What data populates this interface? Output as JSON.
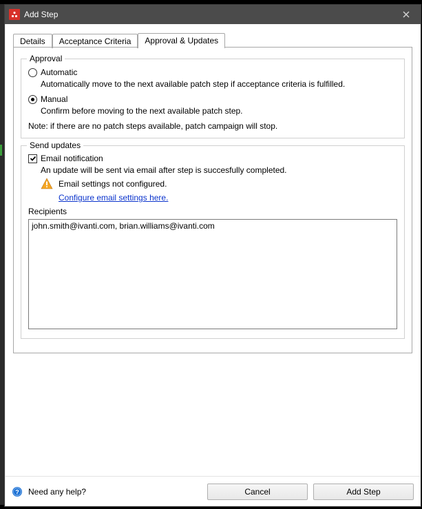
{
  "window": {
    "title": "Add Step"
  },
  "tabs": [
    {
      "label": "Details"
    },
    {
      "label": "Acceptance Criteria"
    },
    {
      "label": "Approval & Updates"
    }
  ],
  "approval": {
    "legend": "Approval",
    "automatic": {
      "label": "Automatic",
      "desc": "Automatically move to the next available patch step if acceptance criteria is fulfilled."
    },
    "manual": {
      "label": "Manual",
      "desc": "Confirm before moving to the next available patch step."
    },
    "note": "Note: if there are no patch steps available, patch campaign will stop.",
    "selected": "manual"
  },
  "updates": {
    "legend": "Send updates",
    "email_checkbox_label": "Email notification",
    "email_checked": true,
    "email_desc": "An update will be sent via email after step is succesfully completed.",
    "warning_text": "Email settings not configured.",
    "configure_link": "Configure email settings here.",
    "recipients_label": "Recipients",
    "recipients_value": "john.smith@ivanti.com, brian.williams@ivanti.com"
  },
  "footer": {
    "help_text": "Need any help?",
    "cancel": "Cancel",
    "add_step": "Add Step"
  }
}
